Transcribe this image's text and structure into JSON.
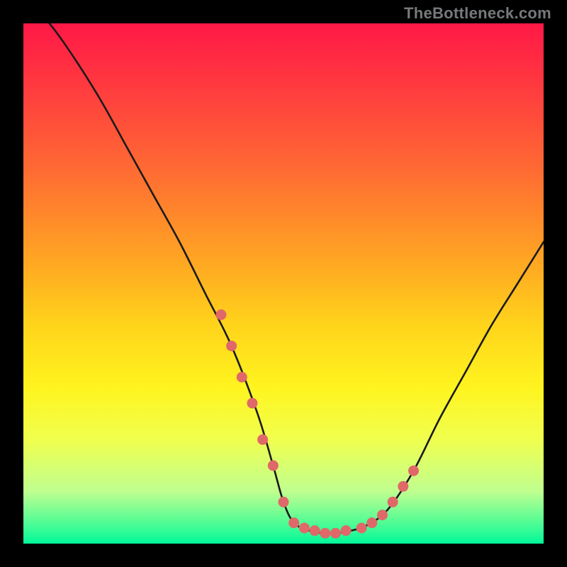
{
  "watermark": "TheBottleneck.com",
  "colors": {
    "background": "#000000",
    "curve": "#1a1a1a",
    "marker_fill": "#e06868",
    "marker_stroke": "#c24e4e",
    "bottom_highlight": "#00f89a"
  },
  "chart_data": {
    "type": "line",
    "title": "",
    "xlabel": "",
    "ylabel": "",
    "xlim": [
      0,
      100
    ],
    "ylim": [
      0,
      100
    ],
    "series": [
      {
        "name": "bottleneck-curve",
        "x": [
          0,
          5,
          10,
          15,
          20,
          25,
          30,
          35,
          40,
          45,
          48,
          50,
          52,
          55,
          58,
          60,
          63,
          66,
          70,
          75,
          80,
          85,
          90,
          95,
          100
        ],
        "y": [
          105,
          100,
          93,
          85,
          76,
          67,
          58,
          48,
          38,
          25,
          15,
          8,
          4,
          2.5,
          2,
          2,
          2.5,
          3.5,
          6.5,
          14,
          24,
          33,
          42,
          50,
          58
        ]
      }
    ],
    "markers": {
      "name": "highlighted-points",
      "x": [
        38,
        40,
        42,
        44,
        46,
        48,
        50,
        52,
        54,
        56,
        58,
        60,
        62,
        65,
        67,
        69,
        71,
        73,
        75
      ],
      "y": [
        44,
        38,
        32,
        27,
        20,
        15,
        8,
        4,
        3,
        2.5,
        2,
        2,
        2.5,
        3,
        4,
        5.5,
        8,
        11,
        14
      ]
    }
  }
}
